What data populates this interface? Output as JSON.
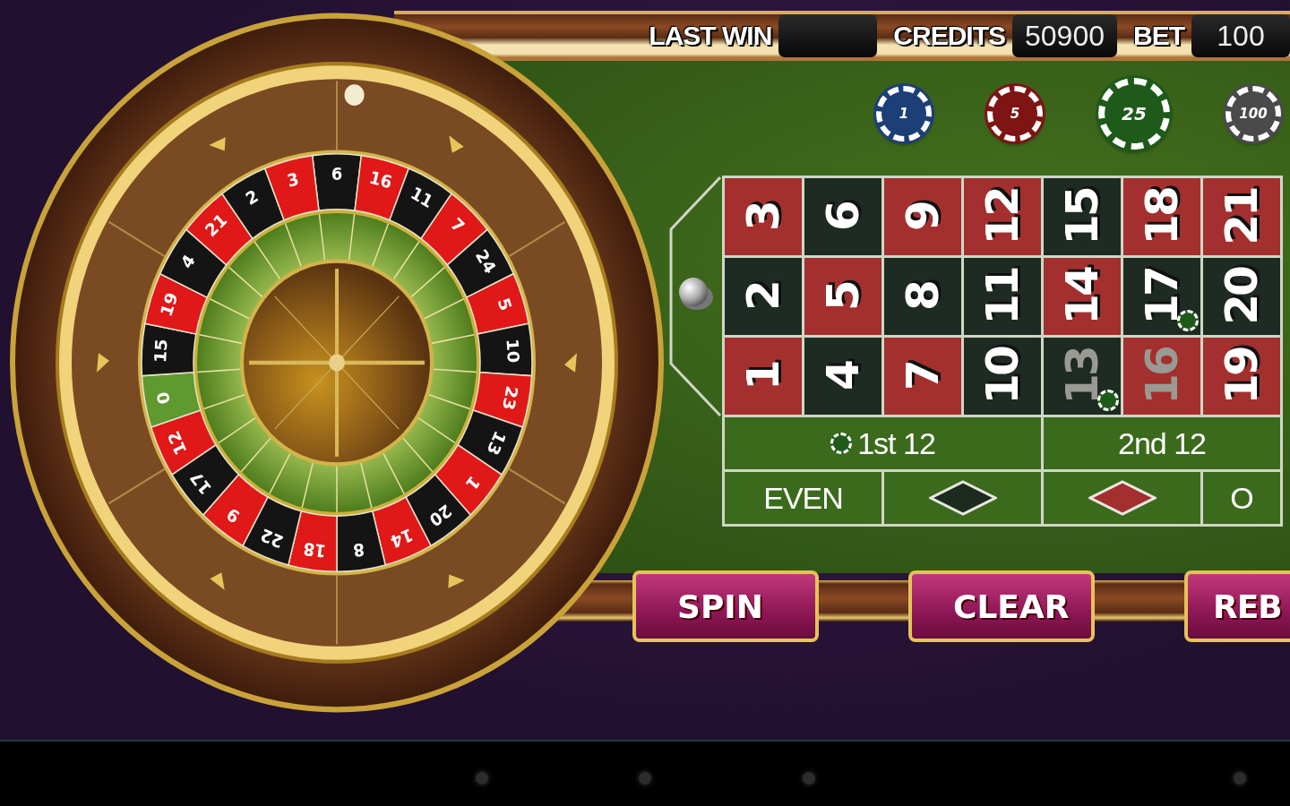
{
  "top_bar": {
    "stats": [
      {
        "label": "LAST WIN"
      },
      {
        "label": "CREDITS",
        "value": "50900"
      },
      {
        "label": "BET",
        "value": "100"
      }
    ]
  },
  "chips": [
    {
      "label": "1",
      "color": "#1d3f78",
      "selected": false
    },
    {
      "label": "5",
      "color": "#7e1414",
      "selected": false
    },
    {
      "label": "25",
      "color": "#1e5a1a",
      "selected": true
    },
    {
      "label": "100",
      "color": "#4a4a4a",
      "selected": false
    }
  ],
  "wheel": {
    "pockets": [
      {
        "number": "6",
        "color": "#141414"
      },
      {
        "number": "16",
        "color": "#e01818"
      },
      {
        "number": "11",
        "color": "#141414"
      },
      {
        "number": "7",
        "color": "#e01818"
      },
      {
        "number": "24",
        "color": "#141414"
      },
      {
        "number": "5",
        "color": "#e01818"
      },
      {
        "number": "10",
        "color": "#141414"
      },
      {
        "number": "23",
        "color": "#e01818"
      },
      {
        "number": "13",
        "color": "#141414"
      },
      {
        "number": "1",
        "color": "#e01818"
      },
      {
        "number": "20",
        "color": "#141414"
      },
      {
        "number": "14",
        "color": "#e01818"
      },
      {
        "number": "8",
        "color": "#141414"
      },
      {
        "number": "18",
        "color": "#e01818"
      },
      {
        "number": "22",
        "color": "#141414"
      },
      {
        "number": "9",
        "color": "#e01818"
      },
      {
        "number": "17",
        "color": "#141414"
      },
      {
        "number": "12",
        "color": "#e01818"
      },
      {
        "number": "0",
        "color": "#5e9a2e"
      },
      {
        "number": "15",
        "color": "#141414"
      },
      {
        "number": "19",
        "color": "#e01818"
      },
      {
        "number": "4",
        "color": "#141414"
      },
      {
        "number": "21",
        "color": "#e01818"
      },
      {
        "number": "2",
        "color": "#141414"
      },
      {
        "number": "3",
        "color": "#e01818"
      }
    ]
  },
  "board": {
    "columns": [
      [
        {
          "number": "3",
          "color": "#a3302e",
          "dimmed": false,
          "chip": false
        },
        {
          "number": "2",
          "color": "#1e2b22",
          "dimmed": false,
          "chip": false
        },
        {
          "number": "1",
          "color": "#a3302e",
          "dimmed": false,
          "chip": false
        }
      ],
      [
        {
          "number": "6",
          "color": "#1e2b22",
          "dimmed": false,
          "chip": false
        },
        {
          "number": "5",
          "color": "#a3302e",
          "dimmed": false,
          "chip": false
        },
        {
          "number": "4",
          "color": "#1e2b22",
          "dimmed": false,
          "chip": false
        }
      ],
      [
        {
          "number": "9",
          "color": "#a3302e",
          "dimmed": false,
          "chip": false
        },
        {
          "number": "8",
          "color": "#1e2b22",
          "dimmed": false,
          "chip": false
        },
        {
          "number": "7",
          "color": "#a3302e",
          "dimmed": false,
          "chip": false
        }
      ],
      [
        {
          "number": "12",
          "color": "#a3302e",
          "dimmed": false,
          "chip": false
        },
        {
          "number": "11",
          "color": "#1e2b22",
          "dimmed": false,
          "chip": false
        },
        {
          "number": "10",
          "color": "#1e2b22",
          "dimmed": false,
          "chip": false
        }
      ],
      [
        {
          "number": "15",
          "color": "#1e2b22",
          "dimmed": false,
          "chip": false
        },
        {
          "number": "14",
          "color": "#a3302e",
          "dimmed": false,
          "chip": false
        },
        {
          "number": "13",
          "color": "#1e2b22",
          "dimmed": true,
          "chip": true
        }
      ],
      [
        {
          "number": "18",
          "color": "#a3302e",
          "dimmed": false,
          "chip": false
        },
        {
          "number": "17",
          "color": "#1e2b22",
          "dimmed": false,
          "chip": true
        },
        {
          "number": "16",
          "color": "#a3302e",
          "dimmed": true,
          "chip": false
        }
      ],
      [
        {
          "number": "21",
          "color": "#a3302e",
          "dimmed": false,
          "chip": false
        },
        {
          "number": "20",
          "color": "#1e2b22",
          "dimmed": false,
          "chip": false
        },
        {
          "number": "19",
          "color": "#a3302e",
          "dimmed": false,
          "chip": false
        }
      ]
    ],
    "dozens": [
      {
        "label": "1st 12",
        "chip": true
      },
      {
        "label": "2nd 12",
        "chip": false
      }
    ],
    "outside": [
      {
        "kind": "text",
        "label": "EVEN"
      },
      {
        "kind": "diamond",
        "color": "#1d2a1f"
      },
      {
        "kind": "diamond",
        "color": "#a3302e"
      },
      {
        "kind": "text",
        "label": "O"
      }
    ]
  },
  "buttons": [
    {
      "label": "SPIN"
    },
    {
      "label": "CLEAR"
    },
    {
      "label": "REB"
    }
  ]
}
